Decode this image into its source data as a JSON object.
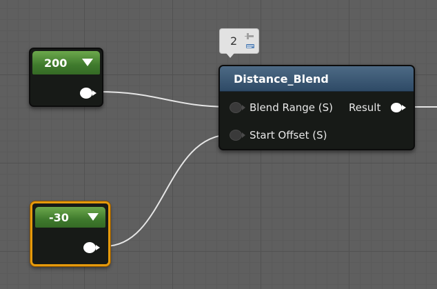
{
  "graph": {
    "constants": [
      {
        "value": "200",
        "selected": false
      },
      {
        "value": "-30",
        "selected": true
      }
    ],
    "function_node": {
      "title": "Distance_Blend",
      "inputs": [
        "Blend Range (S)",
        "Start Offset (S)"
      ],
      "output": "Result"
    },
    "comment_bubble": {
      "count": "2"
    }
  },
  "colors": {
    "canvas": "#5f5f5f",
    "constant_header": "#3f7a2d",
    "function_header": "#2e4a66",
    "selection_outline": "#e59a0c",
    "wire": "#e6e6e6"
  },
  "icons": [
    "dropdown-arrow-icon",
    "pushpin-icon"
  ]
}
